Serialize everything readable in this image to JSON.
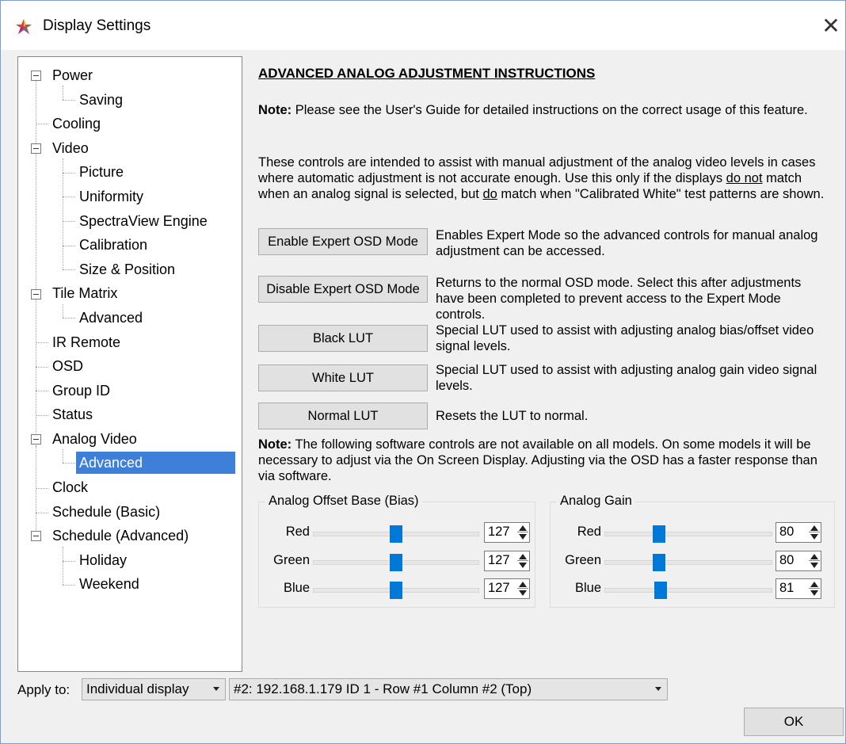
{
  "window": {
    "title": "Display Settings",
    "close_glyph": "✕",
    "app_icon": "color-wheel-icon"
  },
  "tree": {
    "items": [
      {
        "label": "Power"
      },
      {
        "label": "Saving"
      },
      {
        "label": "Cooling"
      },
      {
        "label": "Video"
      },
      {
        "label": "Picture"
      },
      {
        "label": "Uniformity"
      },
      {
        "label": "SpectraView Engine"
      },
      {
        "label": "Calibration"
      },
      {
        "label": "Size & Position"
      },
      {
        "label": "Tile Matrix"
      },
      {
        "label": "Advanced"
      },
      {
        "label": "IR Remote"
      },
      {
        "label": "OSD"
      },
      {
        "label": "Group ID"
      },
      {
        "label": "Status"
      },
      {
        "label": "Analog Video"
      },
      {
        "label": "Advanced"
      },
      {
        "label": "Clock"
      },
      {
        "label": "Schedule (Basic)"
      },
      {
        "label": "Schedule (Advanced)"
      },
      {
        "label": "Holiday"
      },
      {
        "label": "Weekend"
      }
    ],
    "selected": "Analog Video > Advanced"
  },
  "content": {
    "heading": "ADVANCED ANALOG ADJUSTMENT INSTRUCTIONS",
    "note1_bold": "Note:",
    "note1_text": " Please see the User's Guide for detailed instructions on the correct usage of this feature.",
    "para_a": "These controls are intended to assist with manual adjustment of the analog video levels in cases where automatic adjustment is not accurate enough. Use this only if the displays ",
    "para_do_not": "do not",
    "para_b": " match when an analog signal is selected, but ",
    "para_do": "do",
    "para_c": " match when \"Calibrated White\" test patterns are shown.",
    "buttons": [
      {
        "label": "Enable Expert OSD Mode",
        "desc": "Enables Expert Mode so the advanced controls for manual analog adjustment can be accessed."
      },
      {
        "label": "Disable Expert OSD Mode",
        "desc": "Returns to the normal OSD mode. Select this after adjustments have been completed to prevent access to the Expert Mode controls."
      },
      {
        "label": "Black LUT",
        "desc": "Special LUT used to assist with adjusting analog bias/offset video signal levels."
      },
      {
        "label": "White LUT",
        "desc": "Special LUT used to assist with adjusting analog gain video signal levels."
      },
      {
        "label": "Normal LUT",
        "desc": "Resets the LUT to normal."
      }
    ],
    "note2_bold": "Note:",
    "note2_text": " The following software controls are not available on all models. On some models it will be necessary to adjust via the On Screen Display. Adjusting via the OSD has a faster response than via software."
  },
  "offset_group": {
    "title": "Analog Offset Base (Bias)",
    "rows": [
      {
        "label": "Red",
        "value": "127",
        "level": 0.5
      },
      {
        "label": "Green",
        "value": "127",
        "level": 0.5
      },
      {
        "label": "Blue",
        "value": "127",
        "level": 0.5
      }
    ]
  },
  "gain_group": {
    "title": "Analog Gain",
    "rows": [
      {
        "label": "Red",
        "value": "80",
        "level": 0.31
      },
      {
        "label": "Green",
        "value": "80",
        "level": 0.31
      },
      {
        "label": "Blue",
        "value": "81",
        "level": 0.32
      }
    ]
  },
  "footer": {
    "apply_label": "Apply to:",
    "apply_value": "Individual display",
    "display_value": "#2: 192.168.1.179 ID 1 - Row #1 Column #2 (Top)",
    "ok_label": "OK"
  }
}
